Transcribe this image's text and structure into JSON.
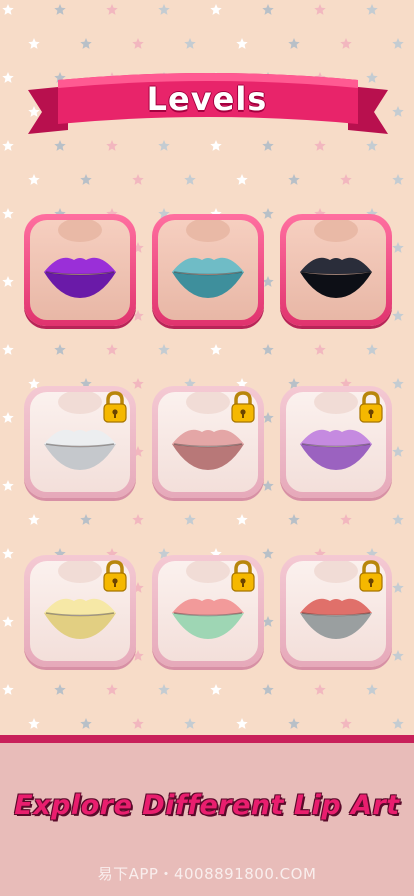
{
  "header": {
    "title": "Levels"
  },
  "colors": {
    "accent": "#e0336e",
    "background": "#f7dcc8",
    "footer": "#e8bcb9",
    "tagline": "#e91e6e"
  },
  "levels": [
    {
      "state": "unlocked",
      "lip_style": "purple-scale-glitter"
    },
    {
      "state": "unlocked",
      "lip_style": "teal-swirl"
    },
    {
      "state": "unlocked",
      "lip_style": "black-lace"
    },
    {
      "state": "locked",
      "lip_style": "silver-love-text"
    },
    {
      "state": "locked",
      "lip_style": "pink-glitter"
    },
    {
      "state": "locked",
      "lip_style": "lavender-glitter"
    },
    {
      "state": "locked",
      "lip_style": "pastel-yellow"
    },
    {
      "state": "locked",
      "lip_style": "watermelon"
    },
    {
      "state": "locked",
      "lip_style": "cat-face"
    }
  ],
  "footer": {
    "tagline": "Explore Different Lip Art",
    "watermark": "易下APP・4008891800.COM"
  }
}
